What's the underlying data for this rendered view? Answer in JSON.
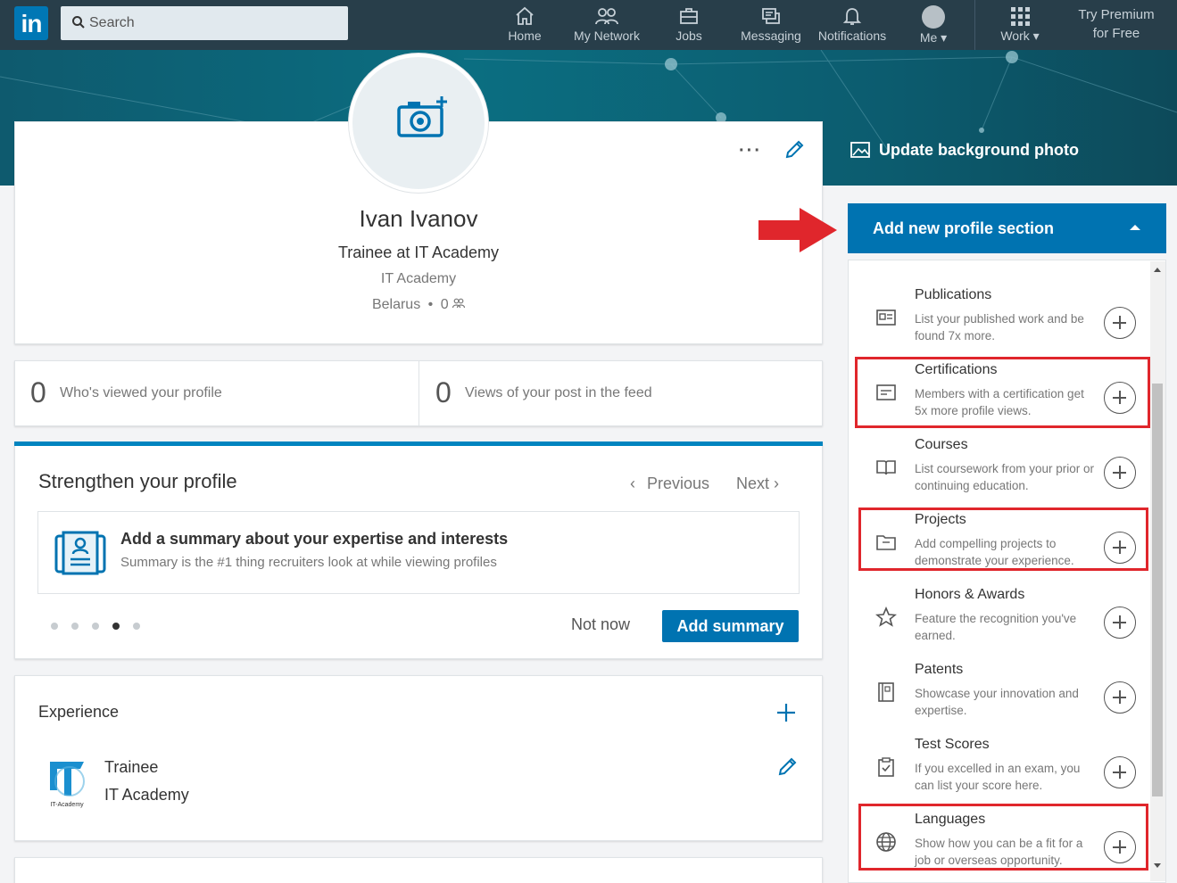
{
  "nav": {
    "logo": "in",
    "search_placeholder": "Search",
    "items": [
      {
        "label": "Home",
        "icon": "home-icon"
      },
      {
        "label": "My Network",
        "icon": "network-icon"
      },
      {
        "label": "Jobs",
        "icon": "briefcase-icon"
      },
      {
        "label": "Messaging",
        "icon": "messaging-icon"
      },
      {
        "label": "Notifications",
        "icon": "bell-icon"
      },
      {
        "label": "Me ▾",
        "icon": "avatar-icon"
      },
      {
        "label": "Work ▾",
        "icon": "grid-icon"
      }
    ],
    "premium_line1": "Try Premium",
    "premium_line2": "for Free"
  },
  "profile": {
    "name": "Ivan Ivanov",
    "headline": "Trainee at IT Academy",
    "company": "IT Academy",
    "location": "Belarus",
    "connections": "0",
    "more": "···"
  },
  "stats": [
    {
      "count": "0",
      "label": "Who's viewed your profile"
    },
    {
      "count": "0",
      "label": "Views of your post in the feed"
    }
  ],
  "strengthen": {
    "title": "Strengthen your profile",
    "previous": "Previous",
    "next": "Next",
    "card_title": "Add a summary about your expertise and interests",
    "card_sub": "Summary is the #1 thing recruiters look at while viewing profiles",
    "not_now": "Not now",
    "add_summary": "Add summary",
    "current_page": 4,
    "total_pages": 5
  },
  "experience": {
    "title": "Experience",
    "role": "Trainee",
    "company": "IT Academy",
    "logo_text": "IT-Academy"
  },
  "right": {
    "update_bg": "Update background photo",
    "add_section": "Add new profile section",
    "sections": [
      {
        "title": "Publications",
        "desc": "List your published work and be found 7x more.",
        "highlighted": false,
        "icon": "publication-icon"
      },
      {
        "title": "Certifications",
        "desc": "Members with a certification get 5x more profile views.",
        "highlighted": true,
        "icon": "certificate-icon"
      },
      {
        "title": "Courses",
        "desc": "List coursework from your prior or continuing education.",
        "highlighted": false,
        "icon": "book-icon"
      },
      {
        "title": "Projects",
        "desc": "Add compelling projects to demonstrate your experience.",
        "highlighted": true,
        "icon": "folder-icon"
      },
      {
        "title": "Honors & Awards",
        "desc": "Feature the recognition you've earned.",
        "highlighted": false,
        "icon": "star-icon"
      },
      {
        "title": "Patents",
        "desc": "Showcase your innovation and expertise.",
        "highlighted": false,
        "icon": "patent-icon"
      },
      {
        "title": "Test Scores",
        "desc": "If you excelled in an exam, you can list your score here.",
        "highlighted": false,
        "icon": "clipboard-icon"
      },
      {
        "title": "Languages",
        "desc": "Show how you can be a fit for a job or overseas opportunity.",
        "highlighted": true,
        "icon": "globe-icon"
      }
    ]
  },
  "colors": {
    "nav_bg": "#283e4a",
    "accent": "#0073b1",
    "highlight": "#e0262c"
  }
}
